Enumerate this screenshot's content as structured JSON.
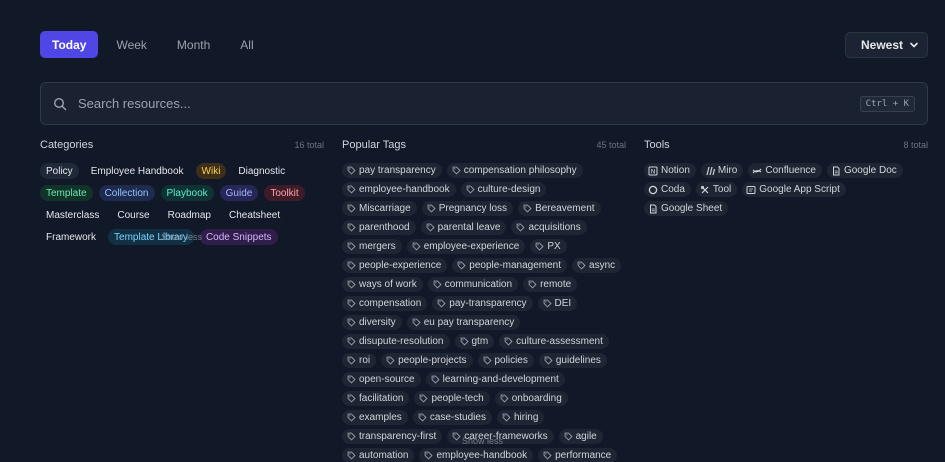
{
  "filters": [
    {
      "label": "Today",
      "active": true
    },
    {
      "label": "Week",
      "active": false
    },
    {
      "label": "Month",
      "active": false
    },
    {
      "label": "All",
      "active": false
    }
  ],
  "sort": {
    "label": "Newest",
    "icon": "chevron-down-icon"
  },
  "search": {
    "placeholder": "Search resources...",
    "shortcut": "Ctrl + K",
    "icon": "search-icon"
  },
  "categories": {
    "title": "Categories",
    "count": "16 total",
    "items": [
      {
        "label": "Policy",
        "bg": "#1f2937",
        "fg": "#e5e7eb"
      },
      {
        "label": "Employee Handbook",
        "bg": "transparent",
        "fg": "#e5e7eb"
      },
      {
        "label": "Wiki",
        "bg": "#3d2f1a",
        "fg": "#fcd34d"
      },
      {
        "label": "Diagnostic",
        "bg": "transparent",
        "fg": "#e5e7eb"
      },
      {
        "label": "Template",
        "bg": "#123328",
        "fg": "#6ee7b7"
      },
      {
        "label": "Collection",
        "bg": "#1e2a4e",
        "fg": "#93c5fd"
      },
      {
        "label": "Playbook",
        "bg": "#0f3332",
        "fg": "#5eead4"
      },
      {
        "label": "Guide",
        "bg": "#262757",
        "fg": "#a5b4fc"
      },
      {
        "label": "Toolkit",
        "bg": "#3d1c28",
        "fg": "#fda4af"
      },
      {
        "label": "Masterclass",
        "bg": "transparent",
        "fg": "#e5e7eb"
      },
      {
        "label": "Course",
        "bg": "transparent",
        "fg": "#e5e7eb"
      },
      {
        "label": "Roadmap",
        "bg": "transparent",
        "fg": "#e5e7eb"
      },
      {
        "label": "Cheatsheet",
        "bg": "transparent",
        "fg": "#e5e7eb"
      },
      {
        "label": "Framework",
        "bg": "transparent",
        "fg": "#e5e7eb"
      },
      {
        "label": "Template Library",
        "bg": "#123044",
        "fg": "#7dd3fc"
      },
      {
        "label": "Code Snippets",
        "bg": "#2f1e49",
        "fg": "#d8b4fe"
      }
    ],
    "overlay_text": "Show less"
  },
  "tags": {
    "title": "Popular Tags",
    "count": "45 total",
    "icon": "tag-icon",
    "items": [
      "pay transparency",
      "compensation philosophy",
      "employee-handbook",
      "culture-design",
      "Miscarriage",
      "Pregnancy loss",
      "Bereavement",
      "parenthood",
      "parental leave",
      "acquisitions",
      "mergers",
      "employee-experience",
      "PX",
      "people-experience",
      "people-management",
      "async",
      "ways of work",
      "communication",
      "remote",
      "compensation",
      "pay-transparency",
      "DEI",
      "diversity",
      "eu pay transparency",
      "disupute-resolution",
      "gtm",
      "culture-assessment",
      "roi",
      "people-projects",
      "policies",
      "guidelines",
      "open-source",
      "learning-and-development",
      "facilitation",
      "people-tech",
      "onboarding",
      "examples",
      "case-studies",
      "hiring",
      "transparency-first",
      "career-frameworks",
      "agile",
      "automation",
      "employee-handbook",
      "performance"
    ],
    "overlay_text": "Show less"
  },
  "tools": {
    "title": "Tools",
    "count": "8 total",
    "items": [
      {
        "label": "Notion",
        "icon": "notion-icon"
      },
      {
        "label": "Miro",
        "icon": "miro-icon"
      },
      {
        "label": "Confluence",
        "icon": "confluence-icon"
      },
      {
        "label": "Google Doc",
        "icon": "document-icon"
      },
      {
        "label": "Coda",
        "icon": "coda-icon"
      },
      {
        "label": "Tool",
        "icon": "tool-icon"
      },
      {
        "label": "Google App Script",
        "icon": "script-icon"
      },
      {
        "label": "Google Sheet",
        "icon": "document-icon"
      }
    ]
  },
  "colors": {
    "accent": "#4f46e5",
    "background": "#111827",
    "chip": "#1e2633"
  }
}
